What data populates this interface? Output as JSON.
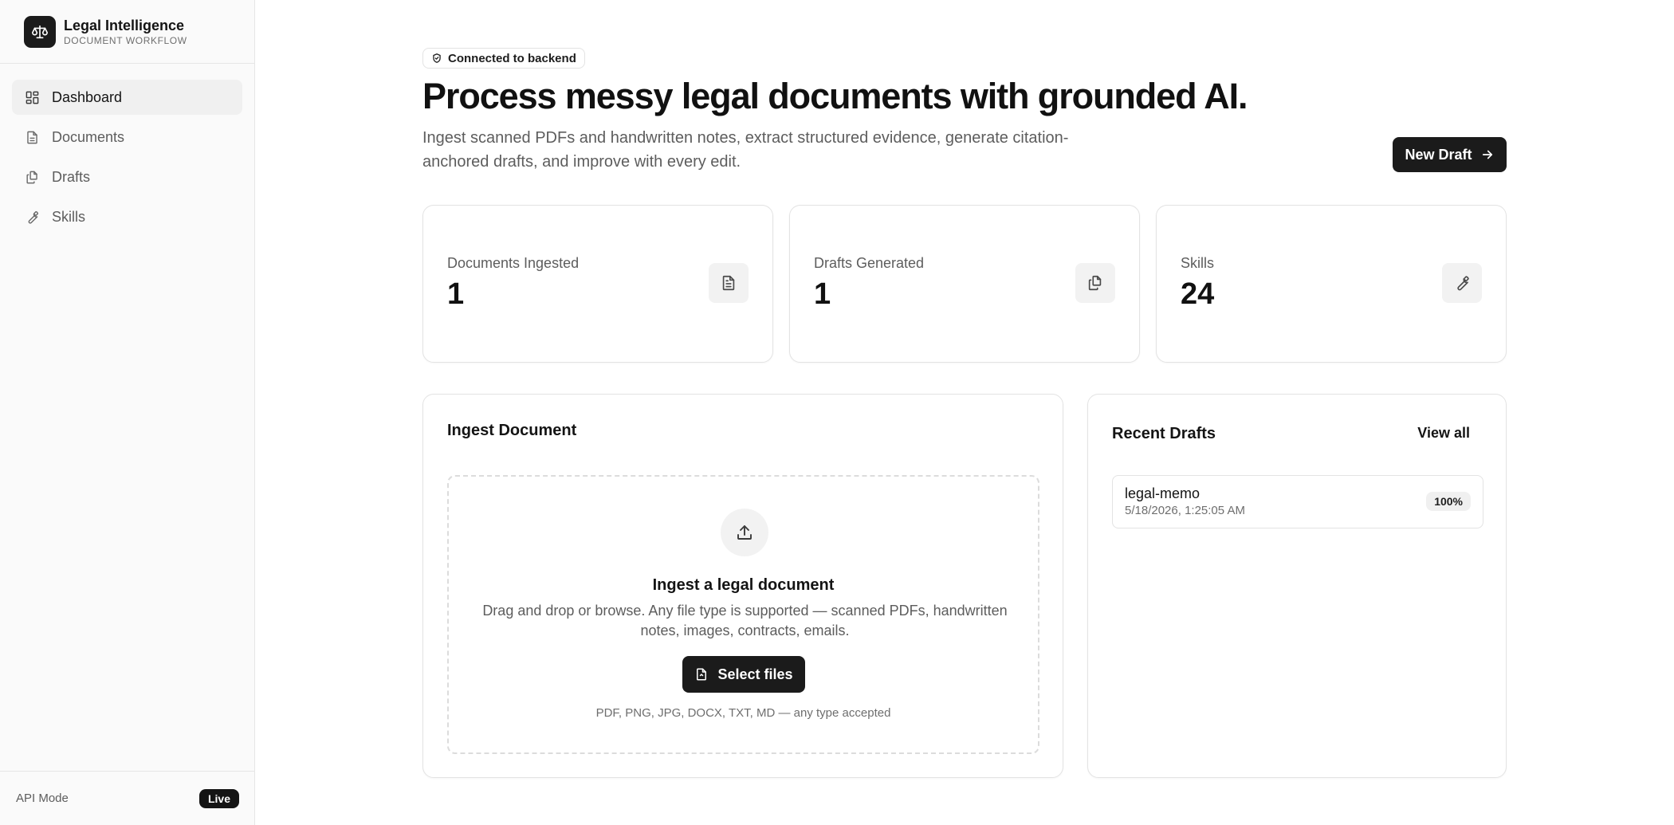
{
  "brand": {
    "title": "Legal Intelligence",
    "subtitle": "DOCUMENT WORKFLOW",
    "icon": "scale-icon"
  },
  "sidebar": {
    "items": [
      {
        "label": "Dashboard",
        "icon": "dashboard-icon",
        "active": true
      },
      {
        "label": "Documents",
        "icon": "document-icon",
        "active": false
      },
      {
        "label": "Drafts",
        "icon": "drafts-icon",
        "active": false
      },
      {
        "label": "Skills",
        "icon": "wrench-icon",
        "active": false
      }
    ],
    "footer": {
      "label": "API Mode",
      "badge": "Live"
    }
  },
  "header": {
    "status": "Connected to backend",
    "title": "Process messy legal documents with grounded AI.",
    "subtitle": "Ingest scanned PDFs and handwritten notes, extract structured evidence, generate citation-anchored drafts, and improve with every edit.",
    "new_draft_label": "New Draft"
  },
  "stats": [
    {
      "label": "Documents Ingested",
      "value": "1",
      "icon": "document-icon"
    },
    {
      "label": "Drafts Generated",
      "value": "1",
      "icon": "drafts-icon"
    },
    {
      "label": "Skills",
      "value": "24",
      "icon": "wrench-icon"
    }
  ],
  "ingest": {
    "title": "Ingest Document",
    "dropzone_title": "Ingest a legal document",
    "dropzone_desc": "Drag and drop or browse. Any file type is supported — scanned PDFs, handwritten notes, images, contracts, emails.",
    "select_label": "Select files",
    "hint": "PDF, PNG, JPG, DOCX, TXT, MD — any type accepted"
  },
  "recent": {
    "title": "Recent Drafts",
    "view_all": "View all",
    "items": [
      {
        "name": "legal-memo",
        "date": "5/18/2026, 1:25:05 AM",
        "score": "100%"
      }
    ]
  },
  "colors": {
    "accent": "#1b1b1b",
    "sidebar_bg": "#fafafa",
    "border": "#e3e3e3",
    "muted_text": "#5d5d5d"
  }
}
